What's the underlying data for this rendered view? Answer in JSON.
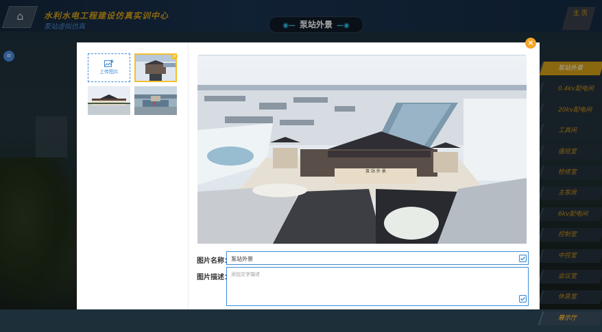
{
  "app": {
    "title": "水利水电工程建设仿真实训中心",
    "subtitle": "泵站虚拟仿真"
  },
  "header": {
    "center_title": "泵站外景",
    "corner_button": "主 页"
  },
  "right_nav": {
    "items": [
      {
        "label": "泵站外景",
        "active": true
      },
      {
        "label": "0.4kv配电间",
        "active": false
      },
      {
        "label": "20kv配电间",
        "active": false
      },
      {
        "label": "工具间",
        "active": false
      },
      {
        "label": "值班室",
        "active": false
      },
      {
        "label": "检修室",
        "active": false
      },
      {
        "label": "主泵房",
        "active": false
      },
      {
        "label": "6kv配电间",
        "active": false
      },
      {
        "label": "控制室",
        "active": false
      },
      {
        "label": "中控室",
        "active": false
      },
      {
        "label": "会议室",
        "active": false
      },
      {
        "label": "休息室",
        "active": false
      },
      {
        "label": "展示厅",
        "active": false
      }
    ]
  },
  "modal": {
    "upload_label": "上传图片",
    "delete_glyph": "×",
    "close_glyph": "×",
    "name_label": "图片名称：",
    "name_value": "泵站外景",
    "desc_label": "图片描述：",
    "desc_placeholder": "添加文字描述",
    "building_plaque": "泵 站 外 景"
  },
  "colors": {
    "accent_blue": "#3a8ad8",
    "gold": "#d4a017",
    "close_orange": "#f5a623"
  },
  "icons": {
    "upload": "image-add-icon",
    "close": "close-circle-icon",
    "edit": "edit-check-icon",
    "home": "home-icon",
    "menu": "menu-icon"
  }
}
